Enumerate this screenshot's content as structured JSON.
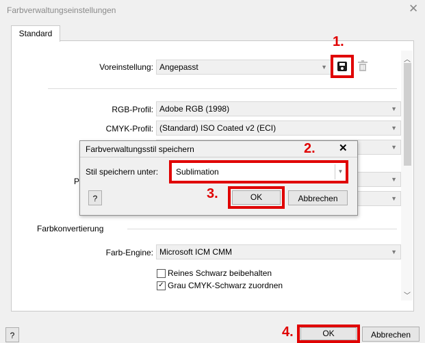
{
  "window": {
    "title": "Farbverwaltungseinstellungen",
    "close_glyph": "✕"
  },
  "tab": {
    "label": "Standard"
  },
  "preset": {
    "label": "Voreinstellung:",
    "value": "Angepasst"
  },
  "profiles": {
    "rgb_label": "RGB-Profil:",
    "rgb_value": "Adobe RGB (1998)",
    "cmyk_label": "CMYK-Profil:",
    "cmyk_value": "(Standard) ISO Coated v2 (ECI)",
    "hidden_label_fragment": "P"
  },
  "conversion": {
    "section_title": "Farbkonvertierung",
    "engine_label": "Farb-Engine:",
    "engine_value": "Microsoft ICM CMM",
    "checkbox1_label": "Reines Schwarz beibehalten",
    "checkbox1_checked": false,
    "checkbox2_label": "Grau CMYK-Schwarz zuordnen",
    "checkbox2_checked": true
  },
  "dialog": {
    "title": "Farbverwaltungsstil speichern",
    "close_glyph": "✕",
    "field_label": "Stil speichern unter:",
    "field_value": "Sublimation",
    "help_label": "?",
    "ok_label": "OK",
    "cancel_label": "Abbrechen"
  },
  "footer": {
    "help_label": "?",
    "ok_label": "OK",
    "cancel_label": "Abbrechen"
  },
  "steps": {
    "s1": "1.",
    "s2": "2.",
    "s3": "3.",
    "s4": "4."
  },
  "colors": {
    "highlight": "#e00000",
    "background": "#f0f0f0",
    "panel": "#ffffff"
  },
  "icons": {
    "save": "save-preset-icon",
    "delete": "trash-icon"
  }
}
